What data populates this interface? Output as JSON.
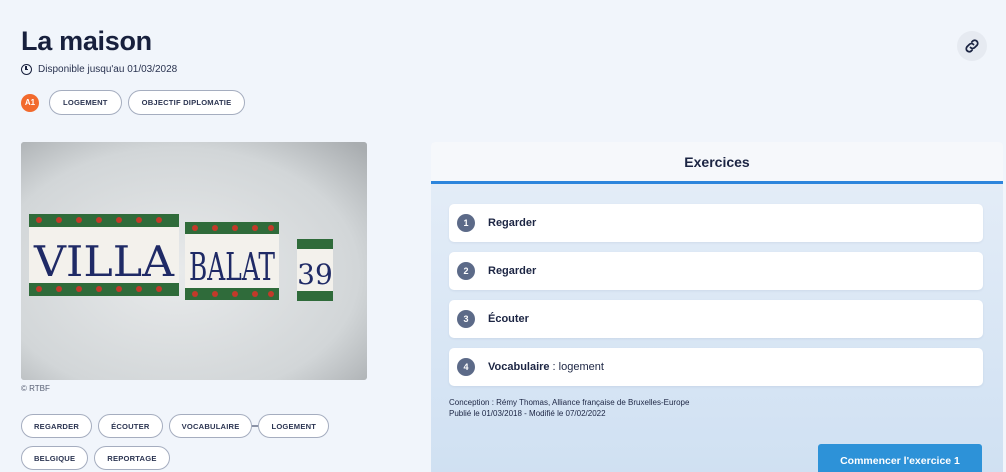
{
  "header": {
    "title": "La maison",
    "availability": "Disponible jusqu'au 01/03/2028",
    "level": "A1",
    "tags": [
      "LOGEMENT",
      "OBJECTIF DIPLOMATIE"
    ]
  },
  "media": {
    "credit": "© RTBF",
    "sign_words": [
      "VILLA",
      "BALAT",
      "39"
    ]
  },
  "bottom_tags": {
    "row1": [
      "REGARDER",
      "ÉCOUTER",
      "VOCABULAIRE",
      "LOGEMENT"
    ],
    "row2": [
      "BELGIQUE",
      "REPORTAGE"
    ]
  },
  "exercises": {
    "heading": "Exercices",
    "items": [
      {
        "num": "1",
        "label": "Regarder",
        "sub": ""
      },
      {
        "num": "2",
        "label": "Regarder",
        "sub": ""
      },
      {
        "num": "3",
        "label": "Écouter",
        "sub": ""
      },
      {
        "num": "4",
        "label": "Vocabulaire",
        "sub": ": logement"
      }
    ],
    "conception": "Conception : Rémy Thomas, Alliance française de Bruxelles-Europe",
    "published": "Publié le 01/03/2018 - Modifié le 07/02/2022",
    "start_button": "Commencer l'exercice 1"
  },
  "colors": {
    "accent": "#2d85dc",
    "level_badge": "#f26a2d",
    "title": "#18203d"
  },
  "icons": {
    "availability": "clock-icon",
    "share": "link-icon"
  }
}
